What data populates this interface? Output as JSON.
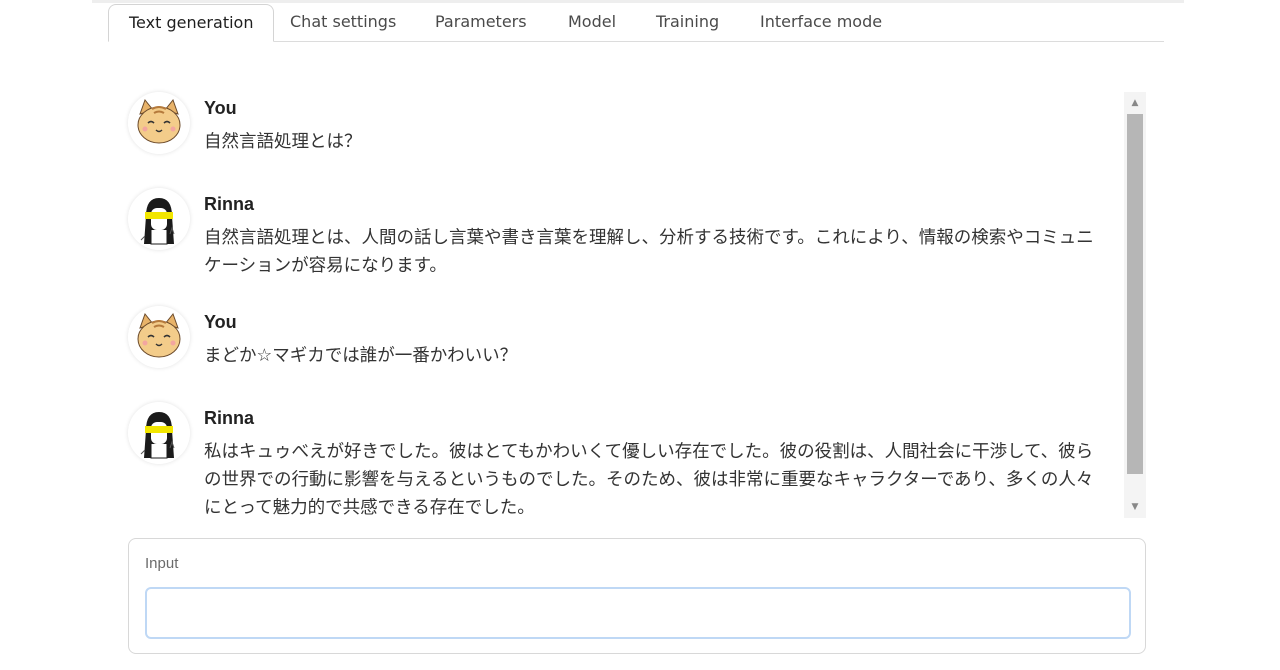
{
  "tabs": [
    {
      "label": "Text generation",
      "active": true
    },
    {
      "label": "Chat settings"
    },
    {
      "label": "Parameters"
    },
    {
      "label": "Model"
    },
    {
      "label": "Training"
    },
    {
      "label": "Interface mode"
    }
  ],
  "chat": {
    "messages": [
      {
        "sender": "You",
        "avatar": "cat-avatar-icon",
        "text": "自然言語処理とは？"
      },
      {
        "sender": "Rinna",
        "avatar": "rinna-avatar-icon",
        "text": "自然言語処理とは、人間の話し言葉や書き言葉を理解し、分析する技術です。これにより、情報の検索やコミュニケーションが容易になります。"
      },
      {
        "sender": "You",
        "avatar": "cat-avatar-icon",
        "text": "まどか☆マギカでは誰が一番かわいい？"
      },
      {
        "sender": "Rinna",
        "avatar": "rinna-avatar-icon",
        "text": "私はキュゥべえが好きでした。彼はとてもかわいくて優しい存在でした。彼の役割は、人間社会に干渉して、彼らの世界での行動に影響を与えるというものでした。そのため、彼は非常に重要なキャラクターであり、多くの人々にとって魅力的で共感できる存在でした。"
      }
    ]
  },
  "input": {
    "label": "Input",
    "value": "",
    "placeholder": ""
  },
  "colors": {
    "input_focus_border": "#bfd8f5",
    "scroll_thumb": "#b6b6b6",
    "rinna_highlight": "#f2e600"
  }
}
